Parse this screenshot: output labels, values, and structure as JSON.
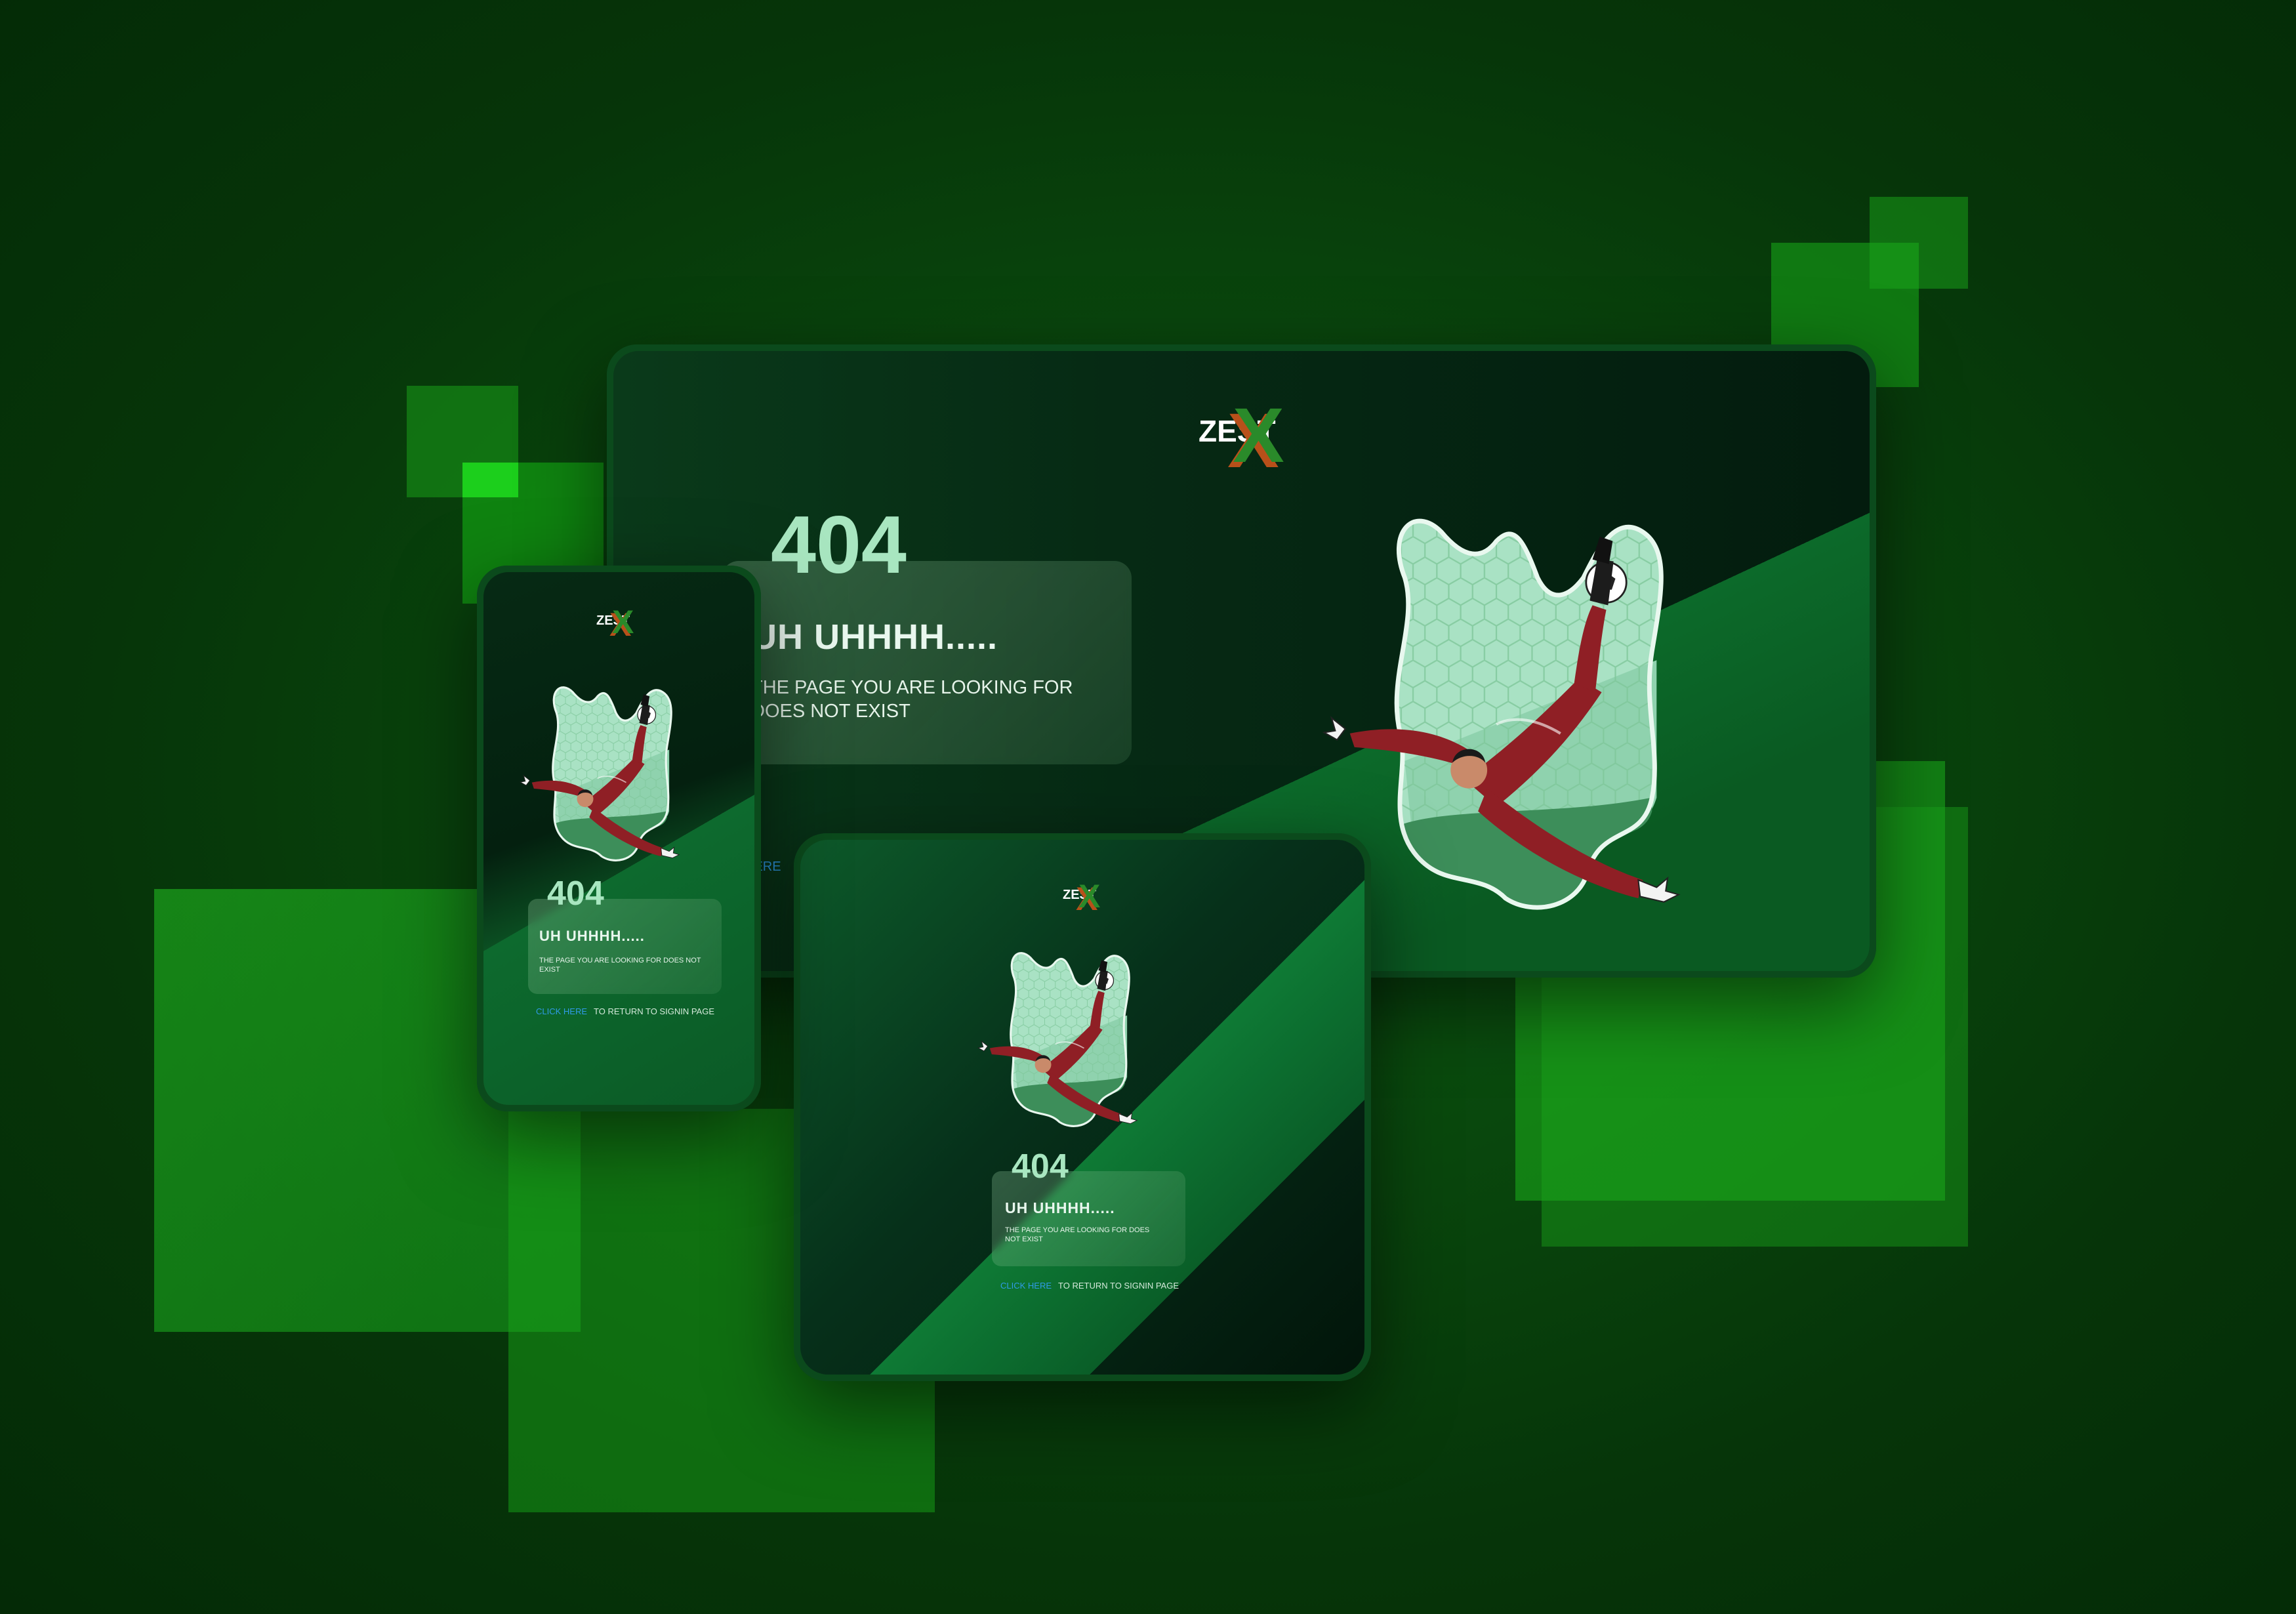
{
  "brand": {
    "logo_text": "ZEST",
    "logo_mark": "X"
  },
  "desktop": {
    "code": "404",
    "headline": "UH UHHHH.....",
    "message": "THE PAGE YOU ARE LOOKING FOR DOES NOT EXIST",
    "link_label": "HERE"
  },
  "phone": {
    "code": "404",
    "headline": "UH UHHHH.....",
    "message": "THE PAGE YOU ARE LOOKING FOR DOES NOT EXIST",
    "link_label": "CLICK HERE",
    "link_suffix": "TO RETURN TO SIGNIN PAGE"
  },
  "tablet": {
    "code": "404",
    "headline": "UH UHHHH.....",
    "message": "THE PAGE YOU ARE LOOKING FOR DOES NOT EXIST",
    "link_label": "CLICK HERE",
    "link_suffix": "TO RETURN TO SIGNIN PAGE"
  },
  "icons": [
    "soccer-player-illustration",
    "soccer-ball-icon",
    "zestx-logo"
  ],
  "colors": {
    "background": "#085010",
    "screen": "#04261a",
    "accent_green": "#a8e6c0",
    "jersey": "#8f1f25",
    "link": "#2f9be8",
    "logo_x_green": "#2a8a2a",
    "logo_x_orange": "#b8501a"
  }
}
